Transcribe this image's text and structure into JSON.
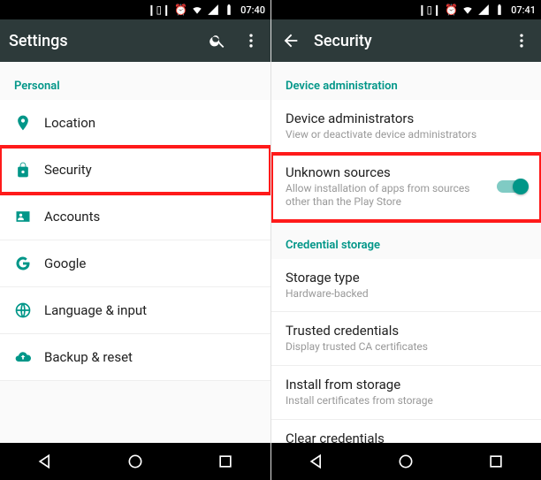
{
  "colors": {
    "accent": "#009688",
    "appbar": "#2d3a3a",
    "highlight": "#ff1a1a"
  },
  "left": {
    "status_time": "07:40",
    "appbar_title": "Settings",
    "section": "Personal",
    "items": {
      "location": {
        "label": "Location"
      },
      "security": {
        "label": "Security"
      },
      "accounts": {
        "label": "Accounts"
      },
      "google": {
        "label": "Google"
      },
      "lang": {
        "label": "Language & input"
      },
      "backup": {
        "label": "Backup & reset"
      }
    }
  },
  "right": {
    "status_time": "07:41",
    "appbar_title": "Security",
    "section_admin": "Device administration",
    "section_cred": "Credential storage",
    "items": {
      "admins": {
        "title": "Device administrators",
        "sub": "View or deactivate device administrators"
      },
      "unknown": {
        "title": "Unknown sources",
        "sub": "Allow installation of apps from sources other than the Play Store",
        "enabled": true
      },
      "storage": {
        "title": "Storage type",
        "sub": "Hardware-backed"
      },
      "trusted": {
        "title": "Trusted credentials",
        "sub": "Display trusted CA certificates"
      },
      "install": {
        "title": "Install from storage",
        "sub": "Install certificates from storage"
      },
      "clear": {
        "title": "Clear credentials"
      }
    }
  }
}
